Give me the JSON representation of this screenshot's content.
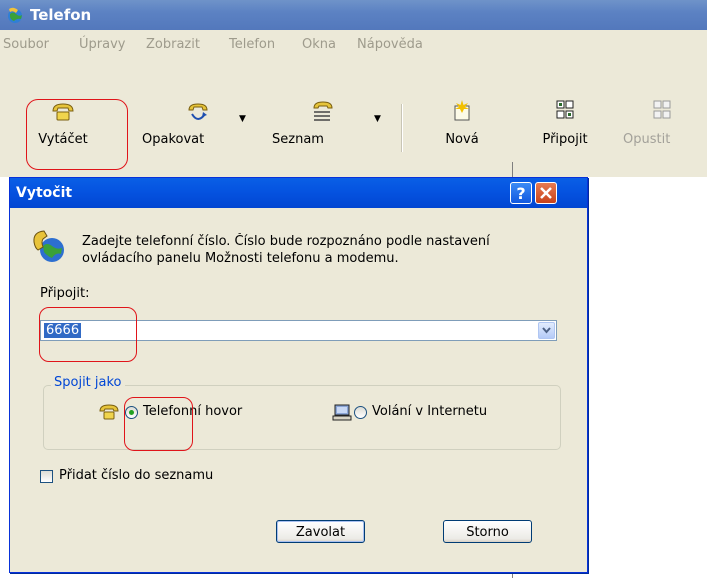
{
  "window": {
    "title": "Telefon"
  },
  "menu": [
    "Soubor",
    "Úpravy",
    "Zobrazit",
    "Telefon",
    "Okna",
    "Nápověda"
  ],
  "toolbar": {
    "dial_label": "Vytáčet",
    "redial_label": "Opakovat",
    "list_label": "Seznam",
    "new_label": "Nová",
    "connect_label": "Připojit",
    "leave_label": "Opustit"
  },
  "dialog": {
    "title": "Vytočit",
    "help_label": "?",
    "intro_text": "Zadejte telefonní číslo. Číslo bude rozpoznáno podle nastavení ovládacího panelu Možnosti telefonu a modemu.",
    "connect_label": "Připojit:",
    "number_value": "6666",
    "group_label": "Spojit jako",
    "option_phone": "Telefonní hovor",
    "option_internet": "Volání v Internetu",
    "selected_option": "Telefonní hovor",
    "add_to_list_label": "Přidat číslo do seznamu",
    "add_to_list_checked": false,
    "call_button": "Zavolat",
    "cancel_button": "Storno"
  },
  "icons": [
    "telephone-icon",
    "redial-icon",
    "phonebook-icon",
    "new-call-icon",
    "connect-icon",
    "leave-icon",
    "help-icon",
    "close-icon",
    "phone-globe-icon",
    "chevron-down-icon",
    "computer-icon"
  ],
  "colors": {
    "title_bar": "#0553e0",
    "window_face": "#ece9d8",
    "highlight_annotation": "#e0141a",
    "selection": "#316ac5"
  }
}
